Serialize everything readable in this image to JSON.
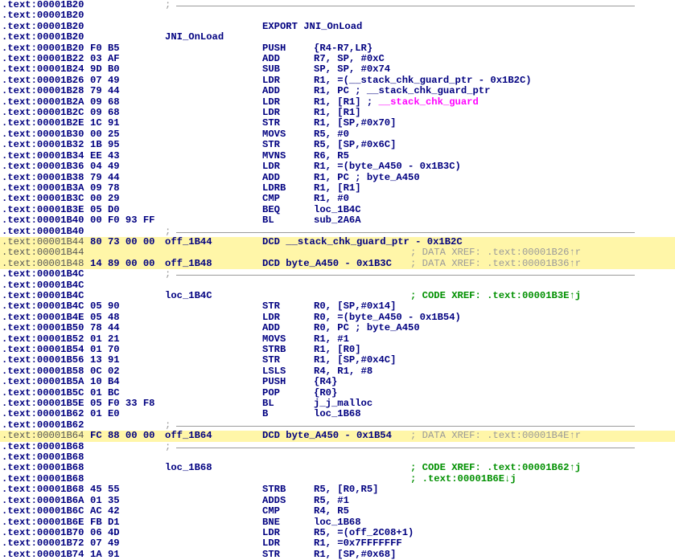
{
  "listing": [
    {
      "addr": ".text:00001B20",
      "sep": ";"
    },
    {
      "addr": ".text:00001B20"
    },
    {
      "addr": ".text:00001B20",
      "mnem": "EXPORT JNI_OnLoad"
    },
    {
      "addr": ".text:00001B20",
      "label": "JNI_OnLoad"
    },
    {
      "addr": ".text:00001B20",
      "bytes": "F0 B5",
      "mnem": "PUSH",
      "ops": "{R4-R7,LR}"
    },
    {
      "addr": ".text:00001B22",
      "bytes": "03 AF",
      "mnem": "ADD",
      "ops": "R7, SP, #0xC"
    },
    {
      "addr": ".text:00001B24",
      "bytes": "9D B0",
      "mnem": "SUB",
      "ops": "SP, SP, #0x74"
    },
    {
      "addr": ".text:00001B26",
      "bytes": "07 49",
      "mnem": "LDR",
      "ops": "R1, =(__stack_chk_guard_ptr - 0x1B2C)"
    },
    {
      "addr": ".text:00001B28",
      "bytes": "79 44",
      "mnem": "ADD",
      "ops": "R1, PC ; __stack_chk_guard_ptr"
    },
    {
      "addr": ".text:00001B2A",
      "bytes": "09 68",
      "mnem": "LDR",
      "ops": "R1, [R1] ; ",
      "ops_magenta": "__stack_chk_guard"
    },
    {
      "addr": ".text:00001B2C",
      "bytes": "09 68",
      "mnem": "LDR",
      "ops": "R1, [R1]"
    },
    {
      "addr": ".text:00001B2E",
      "bytes": "1C 91",
      "mnem": "STR",
      "ops": "R1, [SP,#0x70]"
    },
    {
      "addr": ".text:00001B30",
      "bytes": "00 25",
      "mnem": "MOVS",
      "ops": "R5, #0"
    },
    {
      "addr": ".text:00001B32",
      "bytes": "1B 95",
      "mnem": "STR",
      "ops": "R5, [SP,#0x6C]"
    },
    {
      "addr": ".text:00001B34",
      "bytes": "EE 43",
      "mnem": "MVNS",
      "ops": "R6, R5"
    },
    {
      "addr": ".text:00001B36",
      "bytes": "04 49",
      "mnem": "LDR",
      "ops": "R1, =(byte_A450 - 0x1B3C)"
    },
    {
      "addr": ".text:00001B38",
      "bytes": "79 44",
      "mnem": "ADD",
      "ops": "R1, PC ; byte_A450"
    },
    {
      "addr": ".text:00001B3A",
      "bytes": "09 78",
      "mnem": "LDRB",
      "ops": "R1, [R1]"
    },
    {
      "addr": ".text:00001B3C",
      "bytes": "00 29",
      "mnem": "CMP",
      "ops": "R1, #0"
    },
    {
      "addr": ".text:00001B3E",
      "bytes": "05 D0",
      "mnem": "BEQ",
      "ops": "loc_1B4C"
    },
    {
      "addr": ".text:00001B40",
      "bytes": "00 F0 93 FF",
      "mnem": "BL",
      "ops": "sub_2A6A"
    },
    {
      "addr": ".text:00001B40",
      "sep": ";"
    },
    {
      "addr": ".text:00001B44",
      "plain": true,
      "data": true,
      "bytes": "80 73 00 00",
      "label": "off_1B44",
      "dcd": "DCD __stack_chk_guard_ptr - 0x1B2C"
    },
    {
      "addr": ".text:00001B44",
      "plain": true,
      "data": true,
      "right": "; DATA XREF: .text:00001B26↑r"
    },
    {
      "addr": ".text:00001B48",
      "plain": true,
      "data": true,
      "bytes": "14 89 00 00",
      "label": "off_1B48",
      "dcd": "DCD byte_A450 - 0x1B3C",
      "right_inline": "; DATA XREF: .text:00001B36↑r"
    },
    {
      "addr": ".text:00001B4C",
      "sep": ";"
    },
    {
      "addr": ".text:00001B4C"
    },
    {
      "addr": ".text:00001B4C",
      "label": "loc_1B4C",
      "right_green": "; CODE XREF: .text:00001B3E↑j"
    },
    {
      "addr": ".text:00001B4C",
      "bytes": "05 90",
      "mnem": "STR",
      "ops": "R0, [SP,#0x14]"
    },
    {
      "addr": ".text:00001B4E",
      "bytes": "05 48",
      "mnem": "LDR",
      "ops": "R0, =(byte_A450 - 0x1B54)"
    },
    {
      "addr": ".text:00001B50",
      "bytes": "78 44",
      "mnem": "ADD",
      "ops": "R0, PC ; byte_A450"
    },
    {
      "addr": ".text:00001B52",
      "bytes": "01 21",
      "mnem": "MOVS",
      "ops": "R1, #1"
    },
    {
      "addr": ".text:00001B54",
      "bytes": "01 70",
      "mnem": "STRB",
      "ops": "R1, [R0]"
    },
    {
      "addr": ".text:00001B56",
      "bytes": "13 91",
      "mnem": "STR",
      "ops": "R1, [SP,#0x4C]"
    },
    {
      "addr": ".text:00001B58",
      "bytes": "0C 02",
      "mnem": "LSLS",
      "ops": "R4, R1, #8"
    },
    {
      "addr": ".text:00001B5A",
      "bytes": "10 B4",
      "mnem": "PUSH",
      "ops": "{R4}"
    },
    {
      "addr": ".text:00001B5C",
      "bytes": "01 BC",
      "mnem": "POP",
      "ops": "{R0}"
    },
    {
      "addr": ".text:00001B5E",
      "bytes": "05 F0 33 F8",
      "mnem": "BL",
      "ops": "j_j_malloc"
    },
    {
      "addr": ".text:00001B62",
      "bytes": "01 E0",
      "mnem": "B",
      "ops": "loc_1B68"
    },
    {
      "addr": ".text:00001B62",
      "sep": ";"
    },
    {
      "addr": ".text:00001B64",
      "plain": true,
      "data": true,
      "bytes": "FC 88 00 00",
      "label": "off_1B64",
      "dcd": "DCD byte_A450 - 0x1B54",
      "right_inline": "; DATA XREF: .text:00001B4E↑r"
    },
    {
      "addr": ".text:00001B68",
      "sep": ";"
    },
    {
      "addr": ".text:00001B68"
    },
    {
      "addr": ".text:00001B68",
      "label": "loc_1B68",
      "right_green": "; CODE XREF: .text:00001B62↑j"
    },
    {
      "addr": ".text:00001B68",
      "right_green": "; .text:00001B6E↓j"
    },
    {
      "addr": ".text:00001B68",
      "bytes": "45 55",
      "mnem": "STRB",
      "ops": "R5, [R0,R5]"
    },
    {
      "addr": ".text:00001B6A",
      "bytes": "01 35",
      "mnem": "ADDS",
      "ops": "R5, #1"
    },
    {
      "addr": ".text:00001B6C",
      "bytes": "AC 42",
      "mnem": "CMP",
      "ops": "R4, R5"
    },
    {
      "addr": ".text:00001B6E",
      "bytes": "FB D1",
      "mnem": "BNE",
      "ops": "loc_1B68"
    },
    {
      "addr": ".text:00001B70",
      "bytes": "06 4D",
      "mnem": "LDR",
      "ops": "R5, =(off_2C08+1)"
    },
    {
      "addr": ".text:00001B72",
      "bytes": "07 49",
      "mnem": "LDR",
      "ops": "R1, =0x7FFFFFFF"
    },
    {
      "addr": ".text:00001B74",
      "bytes": "1A 91",
      "mnem": "STR",
      "ops": "R1, [SP,#0x68]"
    }
  ]
}
